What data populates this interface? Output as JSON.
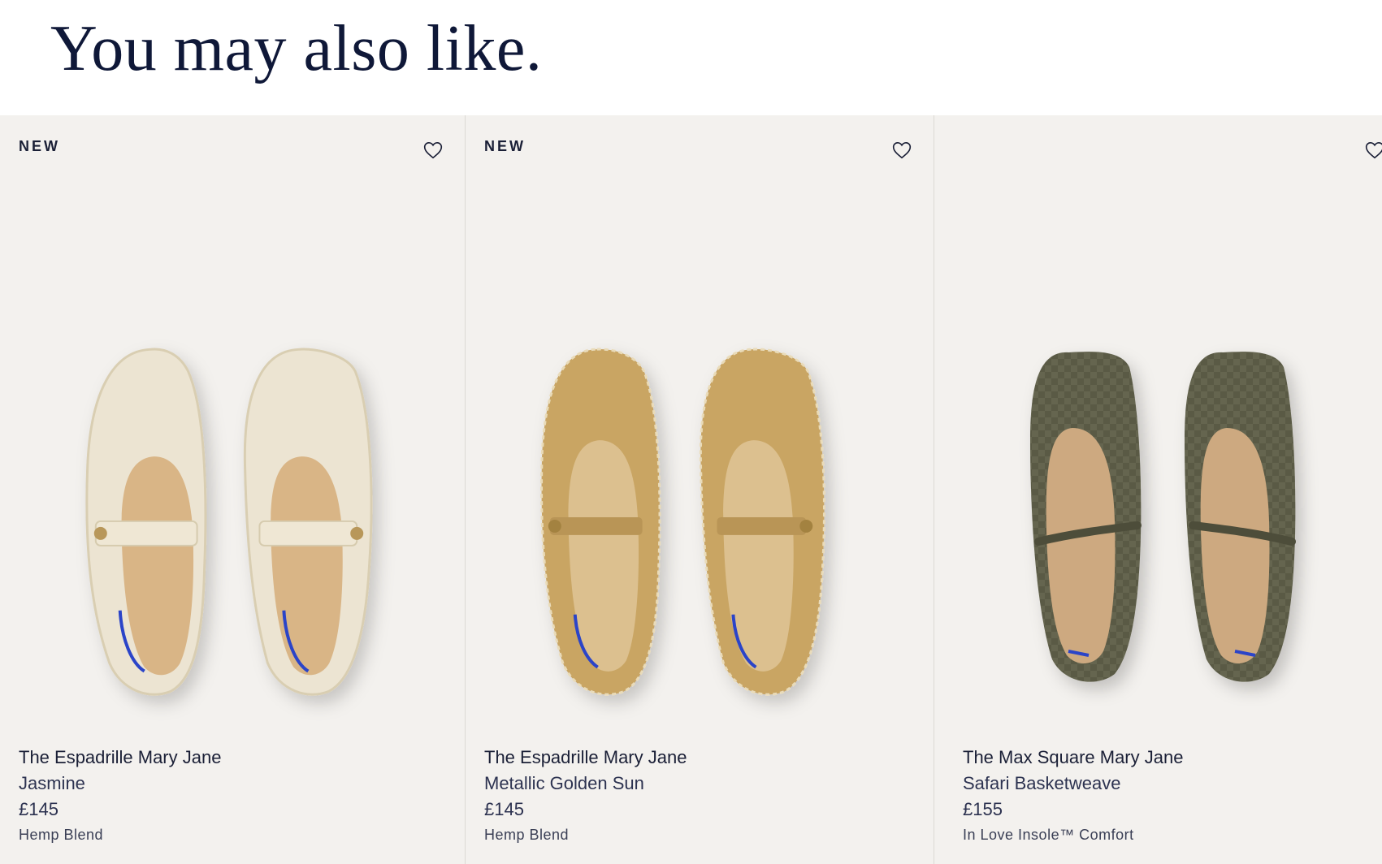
{
  "header": {
    "title": "You may also like."
  },
  "products": [
    {
      "badge": "NEW",
      "name": "The Espadrille Mary Jane",
      "color": "Jasmine",
      "price": "£145",
      "material": "Hemp Blend",
      "shoe_color": "#ece4d2",
      "icon": "heart-icon"
    },
    {
      "badge": "NEW",
      "name": "The Espadrille Mary Jane",
      "color": "Metallic Golden Sun",
      "price": "£145",
      "material": "Hemp Blend",
      "shoe_color": "#c9a564",
      "icon": "heart-icon"
    },
    {
      "badge": "",
      "name": "The Max Square Mary Jane",
      "color": "Safari Basketweave",
      "price": "£155",
      "material": "In Love Insole™ Comfort",
      "shoe_color": "#5a5a45",
      "icon": "heart-icon"
    }
  ]
}
